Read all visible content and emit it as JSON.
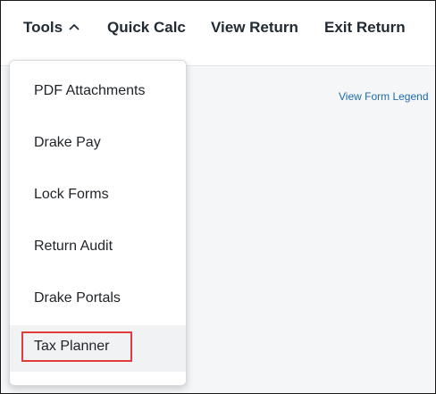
{
  "topbar": {
    "tools_label": "Tools",
    "quick_calc_label": "Quick Calc",
    "view_return_label": "View Return",
    "exit_return_label": "Exit Return"
  },
  "content": {
    "form_legend_link": "View Form Legend"
  },
  "tools_menu": {
    "items": [
      {
        "label": "PDF Attachments"
      },
      {
        "label": "Drake Pay"
      },
      {
        "label": "Lock Forms"
      },
      {
        "label": "Return Audit"
      },
      {
        "label": "Drake Portals"
      },
      {
        "label": "Tax Planner"
      }
    ]
  },
  "colors": {
    "nav_text": "#222a33",
    "link": "#1e6bb0",
    "highlight_box": "#e23b3b",
    "hover_row": "#f1f2f4",
    "content_bg": "#f4f6f8"
  },
  "icons": {
    "tools_toggle": "chevron-up-icon"
  }
}
